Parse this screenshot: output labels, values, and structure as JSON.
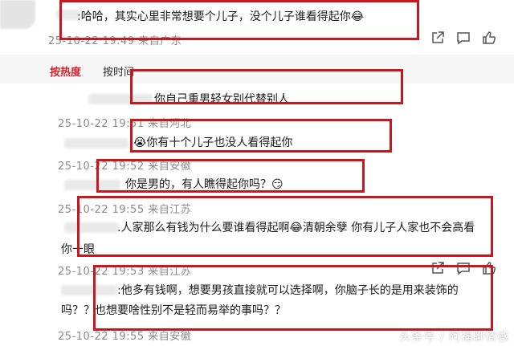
{
  "comments": [
    {
      "text": ":哈哈，其实心里非常想要个儿子，没个儿子谁看得起你",
      "emoji": "😂",
      "meta": "25-10-22 19:49 来自广东"
    },
    {
      "text": "你自己重男轻女别代替别人"
    },
    {
      "text": "你有十个儿子也没人看得起你",
      "emoji": "😭",
      "meta": "25-10-22 19:51 来自河北"
    },
    {
      "text": "你是男的，有人瞧得起你吗？",
      "emoji": "😏",
      "meta": "25-10-22 19:52 来自安徽"
    },
    {
      "text": ".人家那么有钱为什么要谁看得起啊",
      "emoji": "😂",
      "text2": "清朝余孽  你有儿子人家也不会高看",
      "line2": "你一眼",
      "meta": "25-10-22 19:55 来自江苏"
    },
    {
      "text": ":他多有钱啊，想要男孩直接就可以选择啊，你脑子长的是用来装饰的",
      "line2": "吗？？也想要啥性别不是轻而易举的事吗？？",
      "meta": "25-10-22 19:53 来自江苏"
    },
    {
      "meta": "25-10-22 19:55 来自安徽"
    }
  ],
  "sort_tabs": {
    "hot": "按热度",
    "time": "按时间"
  },
  "watermark": "头条号 / 阿福聊情感",
  "colors": {
    "highlight_box": "#c8181e",
    "meta_text": "#8a8a8a",
    "active_tab": "#d4232a"
  },
  "icons": [
    "share-icon",
    "comment-icon",
    "like-icon"
  ]
}
